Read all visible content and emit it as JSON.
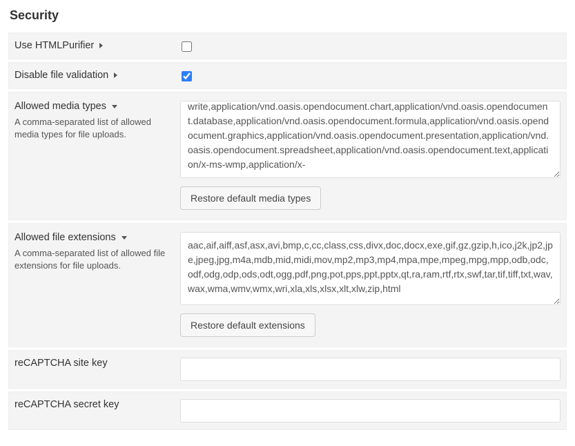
{
  "section_title": "Security",
  "rows": {
    "html_purifier": {
      "label": "Use HTMLPurifier",
      "checked": false
    },
    "disable_validation": {
      "label": "Disable file validation",
      "checked": true
    },
    "media_types": {
      "label": "Allowed media types",
      "help": "A comma-separated list of allowed media types for file uploads.",
      "value": "write,application/vnd.oasis.opendocument.chart,application/vnd.oasis.opendocument.database,application/vnd.oasis.opendocument.formula,application/vnd.oasis.opendocument.graphics,application/vnd.oasis.opendocument.presentation,application/vnd.oasis.opendocument.spreadsheet,application/vnd.oasis.opendocument.text,application/x-ms-wmp,application/x-",
      "button": "Restore default media types"
    },
    "file_exts": {
      "label": "Allowed file extensions",
      "help": "A comma-separated list of allowed file extensions for file uploads.",
      "value": "aac,aif,aiff,asf,asx,avi,bmp,c,cc,class,css,divx,doc,docx,exe,gif,gz,gzip,h,ico,j2k,jp2,jpe,jpeg,jpg,m4a,mdb,mid,midi,mov,mp2,mp3,mp4,mpa,mpe,mpeg,mpg,mpp,odb,odc,odf,odg,odp,ods,odt,ogg,pdf,png,pot,pps,ppt,pptx,qt,ra,ram,rtf,rtx,swf,tar,tif,tiff,txt,wav,wax,wma,wmv,wmx,wri,xla,xls,xlsx,xlt,xlw,zip,html",
      "button": "Restore default extensions"
    },
    "site_key": {
      "label": "reCAPTCHA site key",
      "value": ""
    },
    "secret_key": {
      "label": "reCAPTCHA secret key",
      "value": ""
    }
  }
}
